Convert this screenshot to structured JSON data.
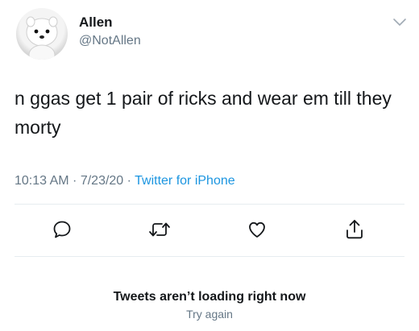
{
  "user": {
    "name": "Allen",
    "handle": "@NotAllen"
  },
  "tweet": {
    "text": "n ggas get 1 pair of ricks and wear em till they morty",
    "timestamp": "10:13 AM · 7/23/20 · ",
    "source": "Twitter for iPhone"
  },
  "actions": {
    "reply": "reply-icon",
    "retweet": "retweet-icon",
    "like": "heart-icon",
    "share": "share-icon"
  },
  "notice": {
    "title": "Tweets aren’t loading right now",
    "retry": "Try again"
  },
  "colors": {
    "text": "#14171a",
    "secondary": "#657786",
    "link": "#1b95e0",
    "divider": "#e6ecf0"
  }
}
